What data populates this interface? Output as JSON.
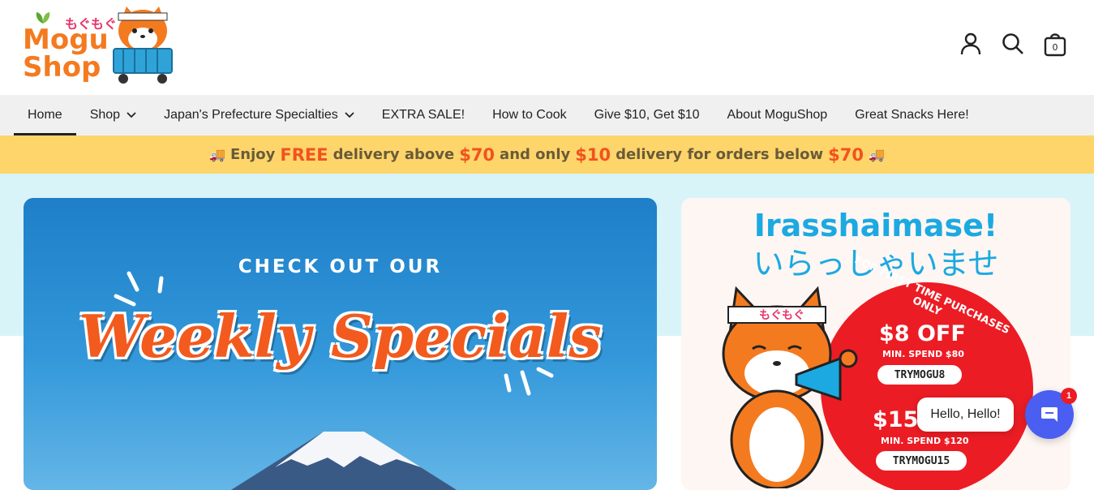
{
  "logo": {
    "line1": "Mogu",
    "line2": "Shop",
    "jp": "もぐもぐ"
  },
  "header": {
    "cart_count": "0",
    "icons": [
      "account-icon",
      "search-icon",
      "cart-icon"
    ]
  },
  "nav": {
    "items": [
      {
        "label": "Home",
        "active": true,
        "dropdown": false
      },
      {
        "label": "Shop",
        "active": false,
        "dropdown": true
      },
      {
        "label": "Japan's Prefecture Specialties",
        "active": false,
        "dropdown": true
      },
      {
        "label": "EXTRA SALE!",
        "active": false,
        "dropdown": false
      },
      {
        "label": "How to Cook",
        "active": false,
        "dropdown": false
      },
      {
        "label": "Give $10, Get $10",
        "active": false,
        "dropdown": false
      },
      {
        "label": "About MoguShop",
        "active": false,
        "dropdown": false
      },
      {
        "label": "Great Snacks Here!",
        "active": false,
        "dropdown": false
      }
    ]
  },
  "banner": {
    "part1": "Enjoy",
    "free": "FREE",
    "part2": "delivery above",
    "amount1": "$70",
    "part3": "and only",
    "amount2": "$10",
    "part4": "delivery for orders below",
    "amount3": "$70"
  },
  "hero_left": {
    "kicker": "CHECK OUT OUR",
    "headline": "Weekly Specials"
  },
  "hero_right": {
    "title": "Irasshaimase!",
    "title_jp": "いらっしゃいませ",
    "mascot_band": "もぐもぐ",
    "promo_arc": "FOR FIRST TIME PURCHASES ONLY",
    "offer1": "$8 OFF",
    "min1": "MIN. SPEND $80",
    "code1": "TRYMOGU8",
    "offer2": "$15",
    "min2": "MIN. SPEND $120",
    "code2": "TRYMOGU15"
  },
  "chat": {
    "greeting": "Hello, Hello!",
    "badge": "1"
  },
  "colors": {
    "brand_orange": "#f47a20",
    "banner_yellow": "#fdd56a",
    "hero_cyan": "#d8f4f8",
    "accent_red": "#ec1c24",
    "chat_blue": "#4a5ef2"
  }
}
